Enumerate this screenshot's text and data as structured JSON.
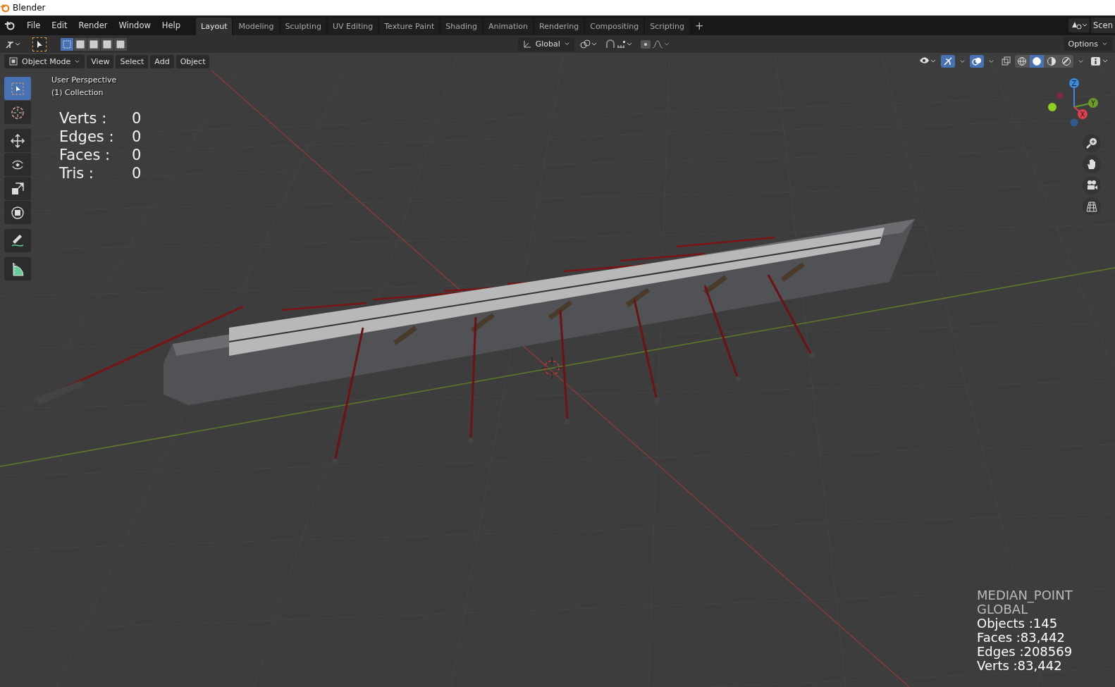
{
  "window": {
    "title": "Blender"
  },
  "menu": [
    "File",
    "Edit",
    "Render",
    "Window",
    "Help"
  ],
  "workspaces": [
    {
      "label": "Layout",
      "selected": true
    },
    {
      "label": "Modeling",
      "selected": false
    },
    {
      "label": "Sculpting",
      "selected": false
    },
    {
      "label": "UV Editing",
      "selected": false
    },
    {
      "label": "Texture Paint",
      "selected": false
    },
    {
      "label": "Shading",
      "selected": false
    },
    {
      "label": "Animation",
      "selected": false
    },
    {
      "label": "Rendering",
      "selected": false
    },
    {
      "label": "Compositing",
      "selected": false
    },
    {
      "label": "Scripting",
      "selected": false
    }
  ],
  "add_workspace": "+",
  "scene": "Scen",
  "tool_header": {
    "select_modes": [
      {
        "selected": true
      },
      {
        "selected": false
      },
      {
        "selected": false
      },
      {
        "selected": false
      },
      {
        "selected": false
      }
    ],
    "orientation": "Global",
    "options": "Options"
  },
  "viewport_header": {
    "mode": "Object Mode",
    "menus": [
      "View",
      "Select",
      "Add",
      "Object"
    ],
    "gizmos_on": true,
    "overlays_on": true,
    "shading": [
      {
        "selected": false
      },
      {
        "selected": true
      },
      {
        "selected": false
      },
      {
        "selected": false
      }
    ]
  },
  "toolbar": [
    {
      "kind": "select",
      "selected": true
    },
    {
      "kind": "cursor",
      "selected": false
    },
    {
      "kind": "move",
      "selected": false
    },
    {
      "kind": "rotate",
      "selected": false
    },
    {
      "kind": "scale",
      "selected": false
    },
    {
      "kind": "transform",
      "selected": false
    },
    {
      "kind": "annotate",
      "selected": false
    },
    {
      "kind": "measure",
      "selected": false
    }
  ],
  "overlay": {
    "view": "User Perspective",
    "collection": "(1) Collection",
    "stats": [
      {
        "label": "Verts :",
        "value": "0"
      },
      {
        "label": "Edges :",
        "value": "0"
      },
      {
        "label": "Faces :",
        "value": "0"
      },
      {
        "label": "Tris :",
        "value": "0"
      }
    ]
  },
  "gizmo": {
    "z": "Z",
    "y": "Y",
    "x": "X"
  },
  "info": {
    "pivot": "MEDIAN_POINT",
    "orientation": "GLOBAL",
    "stats": [
      "Objects :145",
      "Faces :83,442",
      "Edges :208569",
      "Verts :83,442"
    ]
  }
}
